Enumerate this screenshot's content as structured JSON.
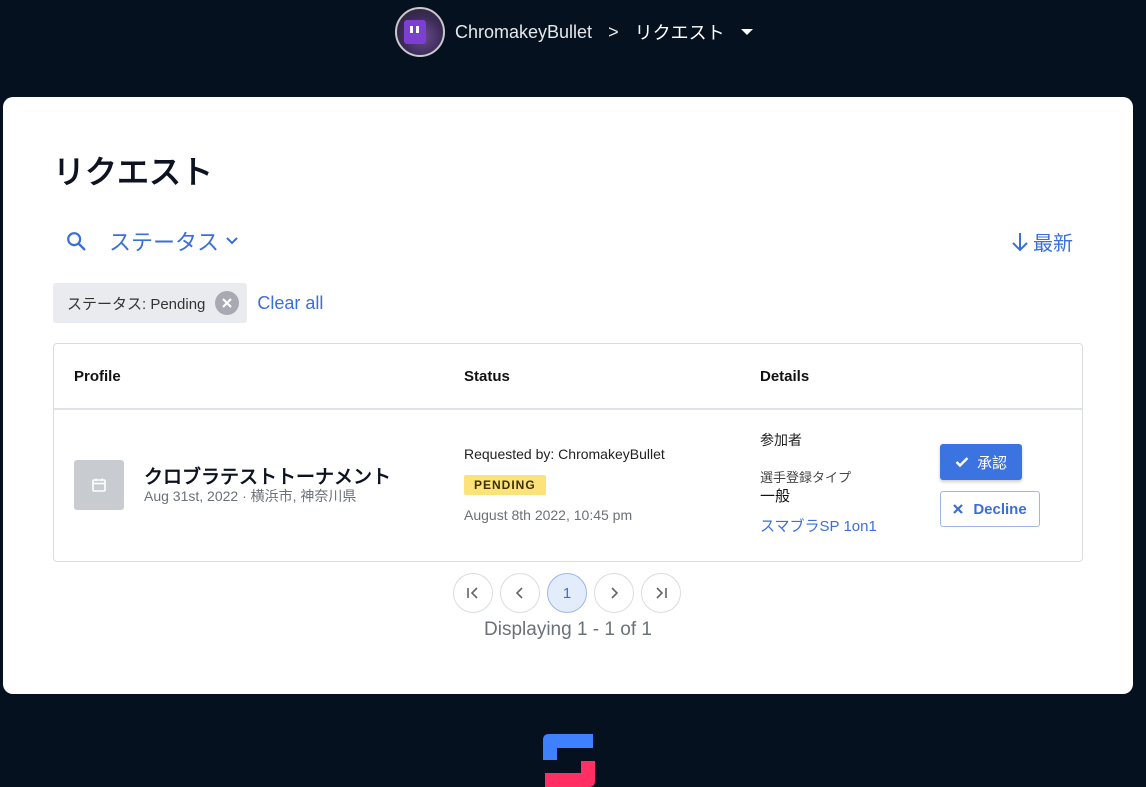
{
  "breadcrumb": {
    "user": "ChromakeyBullet",
    "separator": ">",
    "current": "リクエスト"
  },
  "page": {
    "title": "リクエスト"
  },
  "filters": {
    "status_label": "ステータス",
    "sort_label": "最新",
    "chip_label": "ステータス: Pending",
    "clear_all": "Clear all"
  },
  "table": {
    "headers": [
      "Profile",
      "Status",
      "Details"
    ],
    "rows": [
      {
        "event_name": "クロブラテストトーナメント",
        "event_meta": "Aug 31st, 2022 · 横浜市, 神奈川県",
        "requested_by": "Requested by: ChromakeyBullet",
        "status_badge": "PENDING",
        "requested_at": "August 8th 2022, 10:45 pm",
        "details_label": "参加者",
        "registration_type_label": "選手登録タイプ",
        "registration_type_value": "一般",
        "event_link": "スマブラSP 1on1",
        "approve_label": "承認",
        "decline_label": "Decline"
      }
    ]
  },
  "pagination": {
    "current_page": "1",
    "summary": "Displaying 1 - 1 of 1"
  },
  "colors": {
    "background": "#05111f",
    "accent": "#3b73e0",
    "badge": "#fbe37a"
  }
}
